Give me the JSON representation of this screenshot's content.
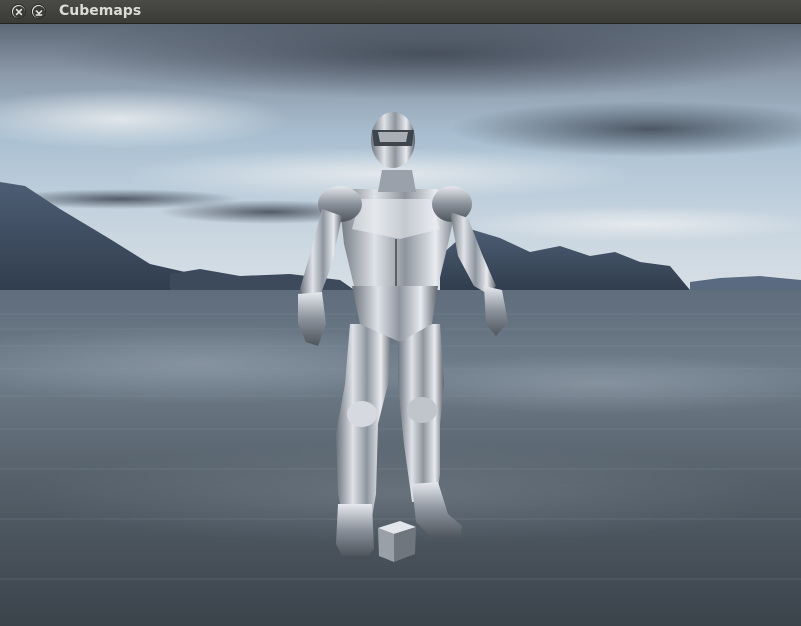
{
  "window": {
    "title": "Cubemaps",
    "buttons": [
      "close",
      "minimize"
    ]
  },
  "scene": {
    "description_icon": "reflective-robot-model",
    "objects": [
      "skybox-cubemap",
      "reflective-character-model",
      "small-cube"
    ],
    "colors": {
      "sky_top": "#3c4a5a",
      "sky_mid": "#9fb3c6",
      "water": "#4a5560",
      "chrome": "#c8ccd2"
    }
  }
}
